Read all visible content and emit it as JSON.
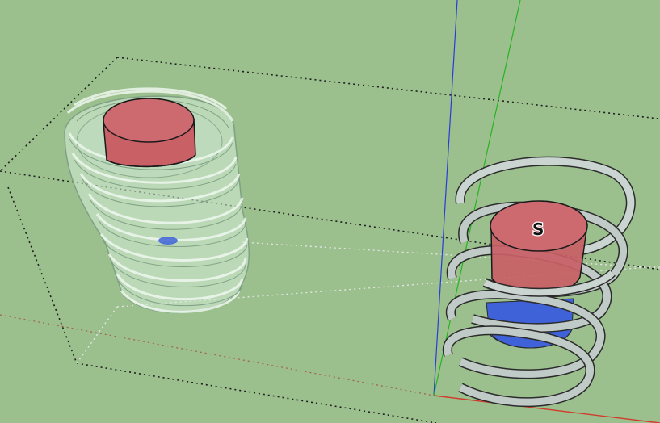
{
  "viewport": {
    "background": "#9bc08e",
    "axes": {
      "x_axis_color": "#d13b2b",
      "y_axis_color": "#27b321",
      "z_axis_color": "#2a3bd8"
    }
  },
  "models": [
    {
      "id": "coil-model-left",
      "magnet_north_color": "#c96066",
      "magnet_south_color": "#3f62d8",
      "coil_color": "#dff0e4",
      "label": ""
    },
    {
      "id": "coil-model-right",
      "magnet_north_color": "#c96066",
      "magnet_south_color": "#3f62d8",
      "coil_color": "#e6f3ee",
      "label": "S"
    }
  ]
}
